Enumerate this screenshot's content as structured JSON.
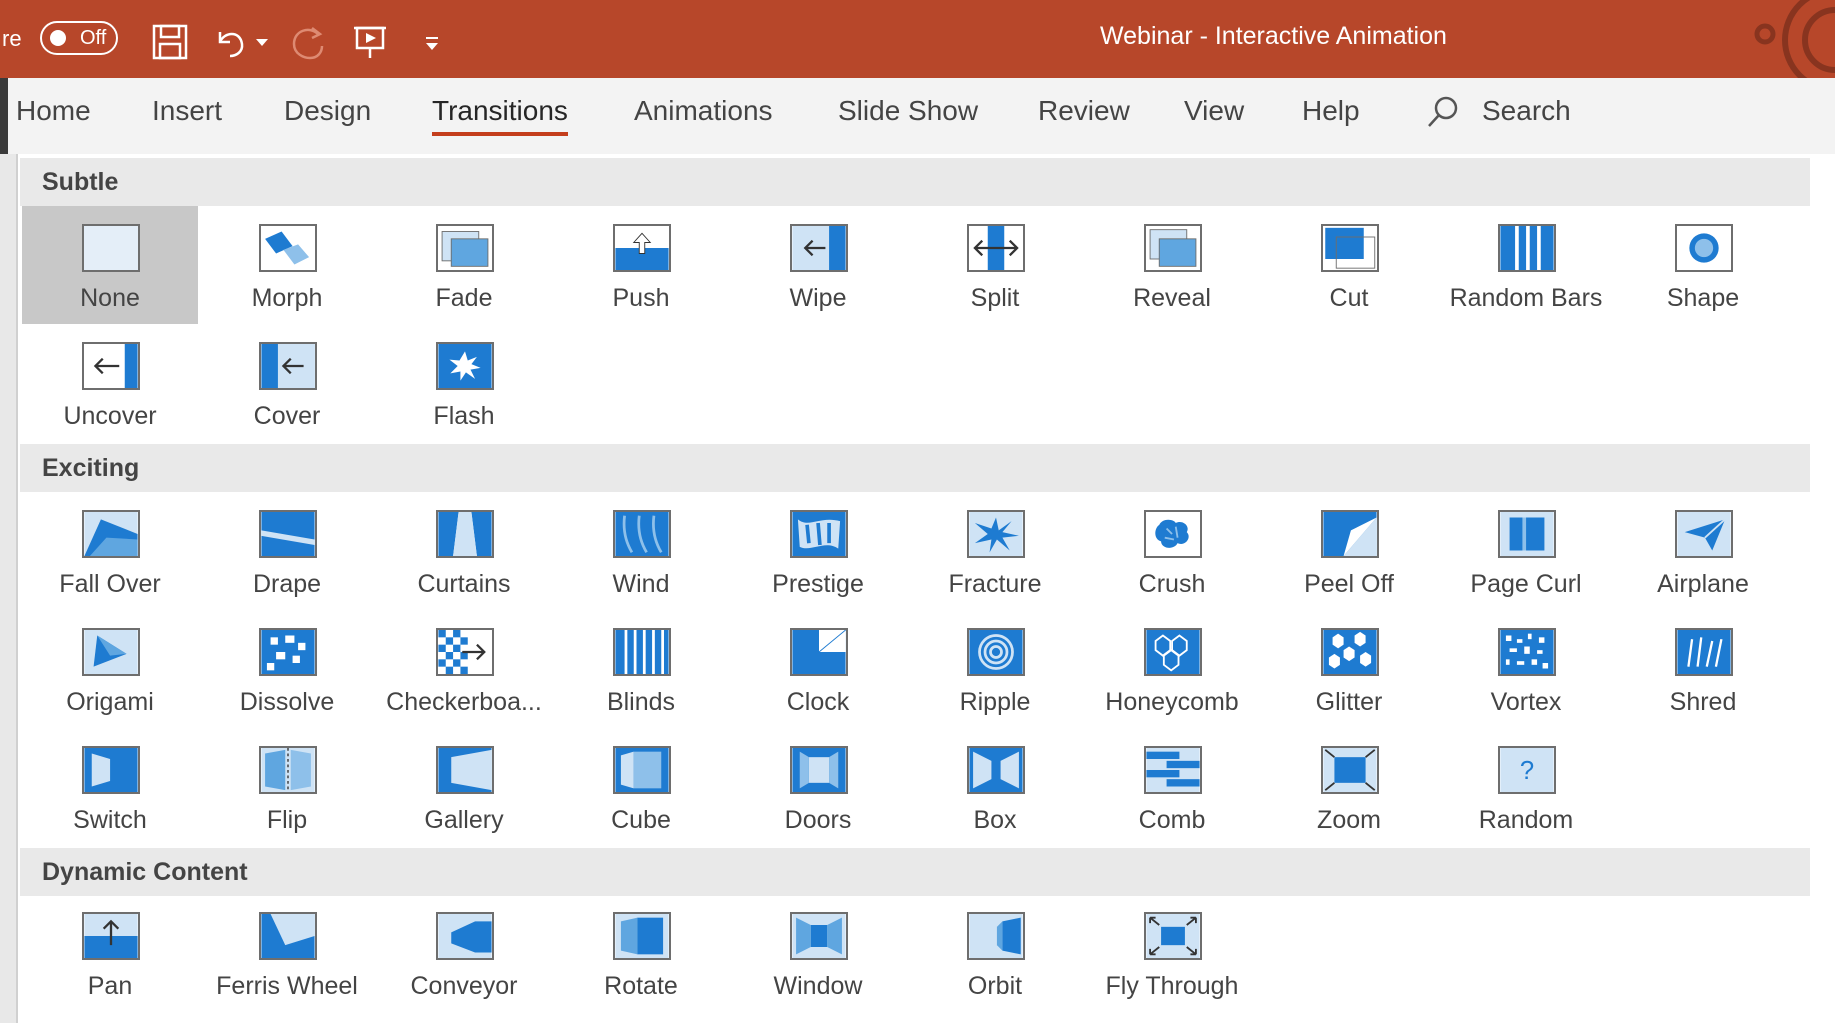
{
  "window": {
    "title": "Webinar - Interactive Animation",
    "autosave_prefix": "re",
    "autosave_state": "Off"
  },
  "colors": {
    "title_bar": "#b7472a",
    "ribbon_bg": "#f3f3f3",
    "active_tab_underline": "#c43e1c",
    "icon_blue": "#1e7bd1",
    "icon_light_blue": "#cfe3f5",
    "selected_item_bg": "#c8c8c8",
    "section_header_bg": "#e9e9e9"
  },
  "qat": {
    "icons": [
      "save-icon",
      "undo-icon",
      "undo-dropdown-icon",
      "redo-icon",
      "present-from-beginning-icon",
      "customize-qat-icon"
    ]
  },
  "ribbon": {
    "tabs": [
      {
        "label": "Home",
        "active": false
      },
      {
        "label": "Insert",
        "active": false
      },
      {
        "label": "Design",
        "active": false
      },
      {
        "label": "Transitions",
        "active": true
      },
      {
        "label": "Animations",
        "active": false
      },
      {
        "label": "Slide Show",
        "active": false
      },
      {
        "label": "Review",
        "active": false
      },
      {
        "label": "View",
        "active": false
      },
      {
        "label": "Help",
        "active": false
      }
    ],
    "search_label": "Search"
  },
  "gallery": {
    "sections": [
      {
        "title": "Subtle",
        "items": [
          {
            "label": "None",
            "icon": "none-icon",
            "selected": true
          },
          {
            "label": "Morph",
            "icon": "morph-icon"
          },
          {
            "label": "Fade",
            "icon": "fade-icon"
          },
          {
            "label": "Push",
            "icon": "push-icon"
          },
          {
            "label": "Wipe",
            "icon": "wipe-icon"
          },
          {
            "label": "Split",
            "icon": "split-icon"
          },
          {
            "label": "Reveal",
            "icon": "reveal-icon"
          },
          {
            "label": "Cut",
            "icon": "cut-icon"
          },
          {
            "label": "Random Bars",
            "icon": "random-bars-icon"
          },
          {
            "label": "Shape",
            "icon": "shape-icon"
          },
          {
            "label": "Uncover",
            "icon": "uncover-icon"
          },
          {
            "label": "Cover",
            "icon": "cover-icon"
          },
          {
            "label": "Flash",
            "icon": "flash-icon"
          }
        ]
      },
      {
        "title": "Exciting",
        "items": [
          {
            "label": "Fall Over",
            "icon": "fall-over-icon"
          },
          {
            "label": "Drape",
            "icon": "drape-icon"
          },
          {
            "label": "Curtains",
            "icon": "curtains-icon"
          },
          {
            "label": "Wind",
            "icon": "wind-icon"
          },
          {
            "label": "Prestige",
            "icon": "prestige-icon"
          },
          {
            "label": "Fracture",
            "icon": "fracture-icon"
          },
          {
            "label": "Crush",
            "icon": "crush-icon"
          },
          {
            "label": "Peel Off",
            "icon": "peel-off-icon"
          },
          {
            "label": "Page Curl",
            "icon": "page-curl-icon"
          },
          {
            "label": "Airplane",
            "icon": "airplane-icon"
          },
          {
            "label": "Origami",
            "icon": "origami-icon"
          },
          {
            "label": "Dissolve",
            "icon": "dissolve-icon"
          },
          {
            "label": "Checkerboa...",
            "icon": "checkerboard-icon"
          },
          {
            "label": "Blinds",
            "icon": "blinds-icon"
          },
          {
            "label": "Clock",
            "icon": "clock-icon"
          },
          {
            "label": "Ripple",
            "icon": "ripple-icon"
          },
          {
            "label": "Honeycomb",
            "icon": "honeycomb-icon"
          },
          {
            "label": "Glitter",
            "icon": "glitter-icon"
          },
          {
            "label": "Vortex",
            "icon": "vortex-icon"
          },
          {
            "label": "Shred",
            "icon": "shred-icon"
          },
          {
            "label": "Switch",
            "icon": "switch-icon"
          },
          {
            "label": "Flip",
            "icon": "flip-icon"
          },
          {
            "label": "Gallery",
            "icon": "gallery-icon"
          },
          {
            "label": "Cube",
            "icon": "cube-icon"
          },
          {
            "label": "Doors",
            "icon": "doors-icon"
          },
          {
            "label": "Box",
            "icon": "box-icon"
          },
          {
            "label": "Comb",
            "icon": "comb-icon"
          },
          {
            "label": "Zoom",
            "icon": "zoom-icon"
          },
          {
            "label": "Random",
            "icon": "random-icon"
          }
        ]
      },
      {
        "title": "Dynamic Content",
        "items": [
          {
            "label": "Pan",
            "icon": "pan-icon"
          },
          {
            "label": "Ferris Wheel",
            "icon": "ferris-wheel-icon"
          },
          {
            "label": "Conveyor",
            "icon": "conveyor-icon"
          },
          {
            "label": "Rotate",
            "icon": "rotate-icon"
          },
          {
            "label": "Window",
            "icon": "window-icon"
          },
          {
            "label": "Orbit",
            "icon": "orbit-icon"
          },
          {
            "label": "Fly Through",
            "icon": "fly-through-icon"
          }
        ]
      }
    ]
  }
}
